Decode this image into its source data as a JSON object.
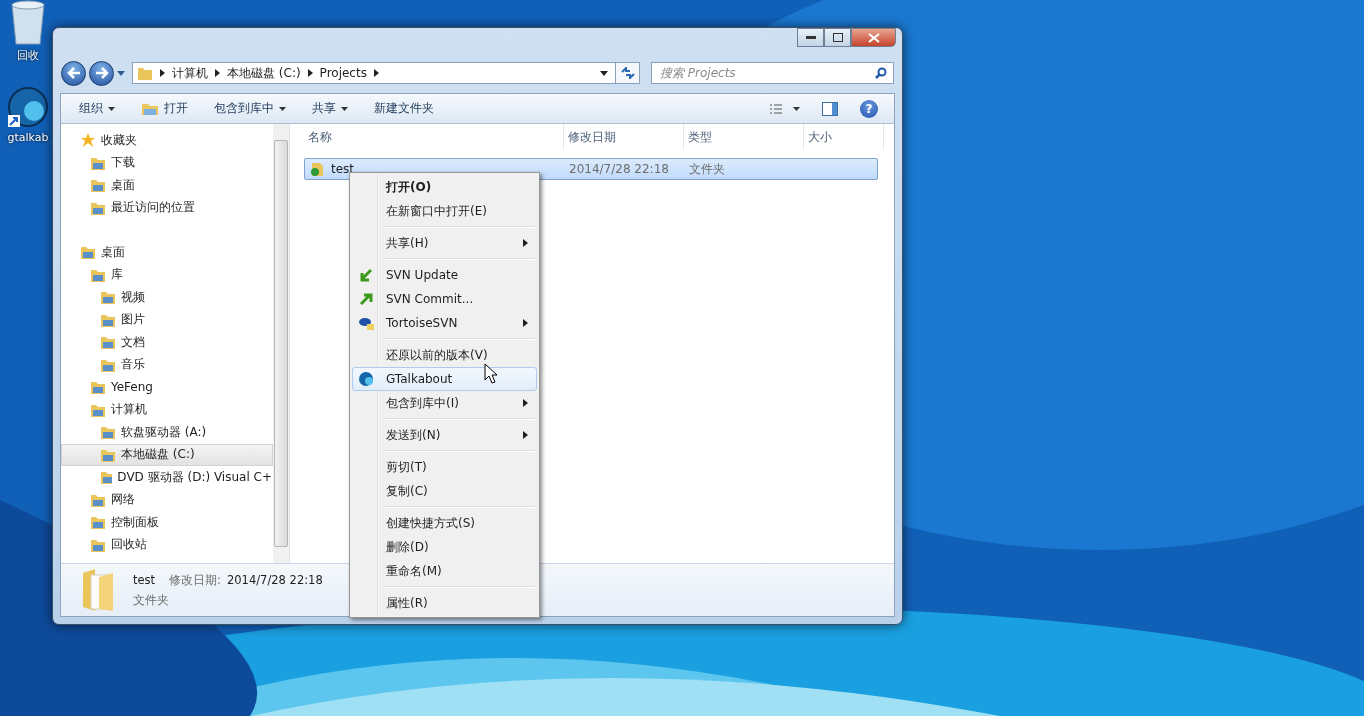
{
  "desktop_icons": [
    {
      "label": "回收"
    },
    {
      "label": "gtalkab"
    }
  ],
  "window": {
    "breadcrumb": [
      "计算机",
      "本地磁盘 (C:)",
      "Projects"
    ],
    "search": {
      "placeholder": "搜索 Projects"
    },
    "toolbar": [
      {
        "label": "打开",
        "dropdown": false,
        "kind": "open"
      },
      {
        "label": "包含到库中",
        "dropdown": true,
        "kind": "plain"
      },
      {
        "label": "共享",
        "dropdown": true,
        "kind": "plain"
      },
      {
        "label": "新建文件夹",
        "dropdown": false,
        "kind": "plain"
      }
    ],
    "organize": {
      "label": "组织",
      "dropdown": true
    },
    "help_button": "?",
    "sidebar": {
      "items": [
        {
          "label": "收藏夹",
          "selected": false,
          "children": [
            {
              "label": "下载",
              "selected": false
            },
            {
              "label": "桌面",
              "selected": false
            },
            {
              "label": "最近访问的位置",
              "selected": false
            }
          ]
        },
        {
          "label": "桌面",
          "selected": false,
          "children": [
            {
              "label": "库",
              "selected": false,
              "children": [
                {
                  "label": "视频",
                  "selected": false
                },
                {
                  "label": "图片",
                  "selected": false
                },
                {
                  "label": "文档",
                  "selected": false
                },
                {
                  "label": "音乐",
                  "selected": false
                }
              ]
            },
            {
              "label": "YeFeng",
              "selected": false
            },
            {
              "label": "计算机",
              "selected": false,
              "children": [
                {
                  "label": "软盘驱动器 (A:)",
                  "selected": false
                },
                {
                  "label": "本地磁盘 (C:)",
                  "selected": true
                },
                {
                  "label": "DVD 驱动器 (D:) Visual C+",
                  "selected": false
                }
              ]
            },
            {
              "label": "网络",
              "selected": false
            },
            {
              "label": "控制面板",
              "selected": false
            },
            {
              "label": "回收站",
              "selected": false
            }
          ]
        }
      ]
    },
    "table": {
      "columns": [
        "名称",
        "修改日期",
        "类型",
        "大小"
      ],
      "rows": [
        {
          "cells": [
            "test",
            "2014/7/28 22:18",
            "文件夹"
          ],
          "selected": true
        }
      ]
    },
    "details": {
      "name": "test",
      "date_label": "修改日期:",
      "date": "2014/7/28 22:18",
      "type": "文件夹"
    }
  },
  "context_menu": [
    {
      "kind": "item",
      "label": "打开(O)",
      "bold": true,
      "submenu": false,
      "selected": false
    },
    {
      "kind": "item",
      "label": "在新窗口中打开(E)",
      "bold": false,
      "submenu": false,
      "selected": false
    },
    {
      "kind": "separator"
    },
    {
      "kind": "item",
      "label": "共享(H)",
      "bold": false,
      "submenu": true,
      "selected": false
    },
    {
      "kind": "separator"
    },
    {
      "kind": "item",
      "label": "SVN Update",
      "bold": false,
      "submenu": false,
      "selected": false
    },
    {
      "kind": "item",
      "label": "SVN Commit...",
      "bold": false,
      "submenu": false,
      "selected": false
    },
    {
      "kind": "item",
      "label": "TortoiseSVN",
      "bold": false,
      "submenu": true,
      "selected": false
    },
    {
      "kind": "separator"
    },
    {
      "kind": "item",
      "label": "还原以前的版本(V)",
      "bold": false,
      "submenu": false,
      "selected": false
    },
    {
      "kind": "item",
      "label": "GTalkabout",
      "bold": false,
      "submenu": false,
      "selected": true
    },
    {
      "kind": "item",
      "label": "包含到库中(I)",
      "bold": false,
      "submenu": true,
      "selected": false
    },
    {
      "kind": "separator"
    },
    {
      "kind": "item",
      "label": "发送到(N)",
      "bold": false,
      "submenu": true,
      "selected": false
    },
    {
      "kind": "separator"
    },
    {
      "kind": "item",
      "label": "剪切(T)",
      "bold": false,
      "submenu": false,
      "selected": false
    },
    {
      "kind": "item",
      "label": "复制(C)",
      "bold": false,
      "submenu": false,
      "selected": false
    },
    {
      "kind": "separator"
    },
    {
      "kind": "item",
      "label": "创建快捷方式(S)",
      "bold": false,
      "submenu": false,
      "selected": false
    },
    {
      "kind": "item",
      "label": "删除(D)",
      "bold": false,
      "submenu": false,
      "selected": false
    },
    {
      "kind": "item",
      "label": "重命名(M)",
      "bold": false,
      "submenu": false,
      "selected": false
    },
    {
      "kind": "separator"
    },
    {
      "kind": "item",
      "label": "属性(R)",
      "bold": false,
      "submenu": false,
      "selected": false
    }
  ]
}
